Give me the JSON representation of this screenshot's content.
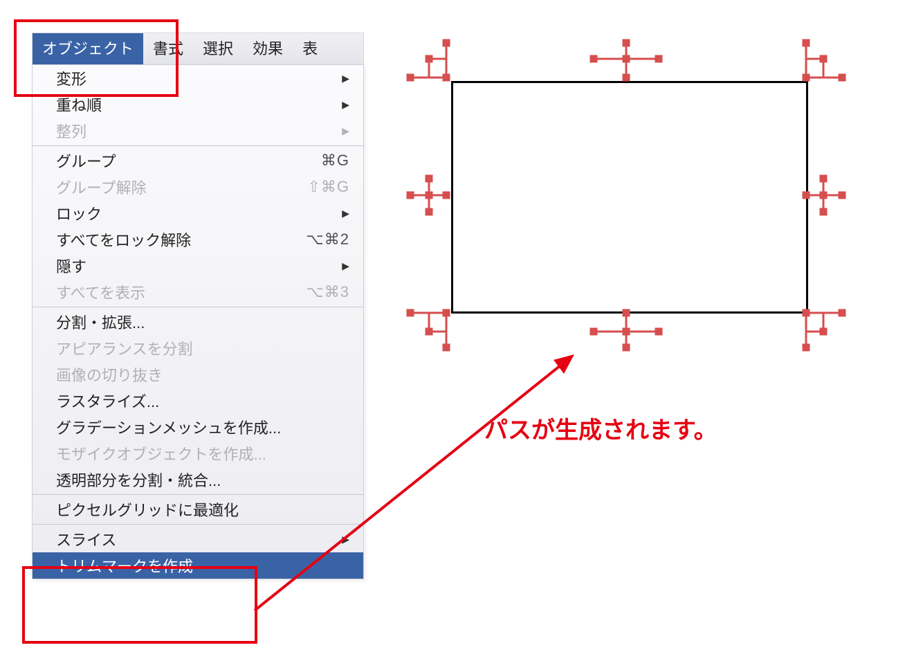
{
  "menubar": {
    "tab_active": "オブジェクト",
    "tab2": "書式",
    "tab3": "選択",
    "tab4": "効果",
    "tab5": "表"
  },
  "menu": {
    "transform": {
      "label": "変形"
    },
    "arrange": {
      "label": "重ね順"
    },
    "align": {
      "label": "整列"
    },
    "group": {
      "label": "グループ",
      "shortcut": "⌘G"
    },
    "ungroup": {
      "label": "グループ解除",
      "shortcut": "⇧⌘G"
    },
    "lock": {
      "label": "ロック"
    },
    "unlockall": {
      "label": "すべてをロック解除",
      "shortcut": "⌥⌘2"
    },
    "hide": {
      "label": "隠す"
    },
    "showall": {
      "label": "すべてを表示",
      "shortcut": "⌥⌘3"
    },
    "expand": {
      "label": "分割・拡張..."
    },
    "flatten_appearance": {
      "label": "アピアランスを分割"
    },
    "crop_image": {
      "label": "画像の切り抜き"
    },
    "rasterize": {
      "label": "ラスタライズ..."
    },
    "gradient_mesh": {
      "label": "グラデーションメッシュを作成..."
    },
    "mosaic": {
      "label": "モザイクオブジェクトを作成..."
    },
    "flatten_trans": {
      "label": "透明部分を分割・統合..."
    },
    "pixel_grid": {
      "label": "ピクセルグリッドに最適化"
    },
    "slice": {
      "label": "スライス"
    },
    "trim_marks": {
      "label": "トリムマークを作成"
    }
  },
  "annotation": {
    "text": "パスが生成されます。"
  },
  "colors": {
    "highlight_red": "#e60012",
    "menu_blue": "#3a63a6",
    "trim_red": "#d64e4e"
  }
}
